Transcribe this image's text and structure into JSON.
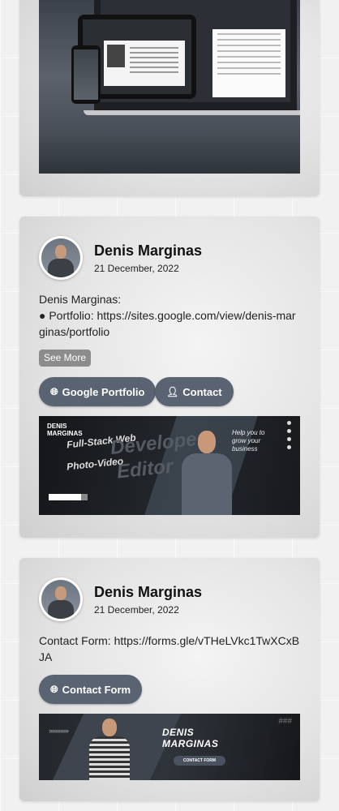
{
  "cards": [
    {
      "type": "image-only",
      "image": "device-mockup-image"
    },
    {
      "author": "Denis Marginas",
      "date": "21 December, 2022",
      "text_line1": "Denis Marginas:",
      "text_line2": "● Portfolio: https://sites.google.com/view/denis-marginas/portfolio",
      "see_more": "See More",
      "buttons": [
        {
          "label": "Google Portfolio",
          "icon": "globe-icon"
        },
        {
          "label": "Contact",
          "icon": "person-icon"
        }
      ],
      "banner": {
        "brand_line1": "DENIS",
        "brand_line2": "MARGINAS",
        "line1": "Full-Stack Web",
        "line2": "Developer",
        "line3": "Photo-Video",
        "line4": "Editor",
        "script": "Help you to grow your business"
      }
    },
    {
      "author": "Denis Marginas",
      "date": "21 December, 2022",
      "text": "Contact Form: https://forms.gle/vTHeLVkc1TwXCxBJA",
      "buttons": [
        {
          "label": "Contact Form",
          "icon": "globe-icon"
        }
      ],
      "banner": {
        "arrows": "»»»»»»",
        "title_line1": "DENIS",
        "title_line2": "MARGINAS",
        "pill": "CONTACT FORM",
        "hash": "###"
      }
    }
  ],
  "colors": {
    "button_bg": "#5a6371",
    "see_more_bg": "#8c8c8c",
    "page_bg": "#f1f1f1"
  }
}
